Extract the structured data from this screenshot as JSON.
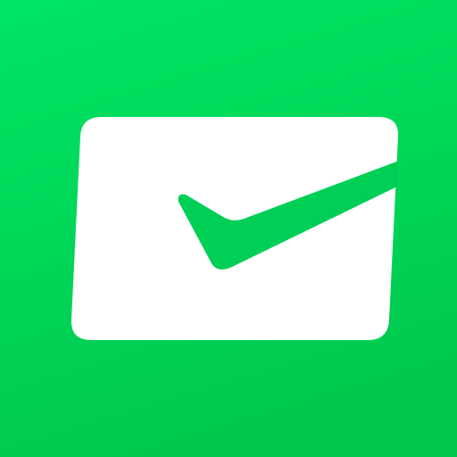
{
  "icon": {
    "name": "check-envelope-app-icon",
    "glyph": "envelope-with-checkmark",
    "colors": {
      "background_top": "#00E564",
      "background_bottom": "#00C94E",
      "envelope": "#FFFFFF",
      "checkmark": "#00CF56"
    }
  }
}
